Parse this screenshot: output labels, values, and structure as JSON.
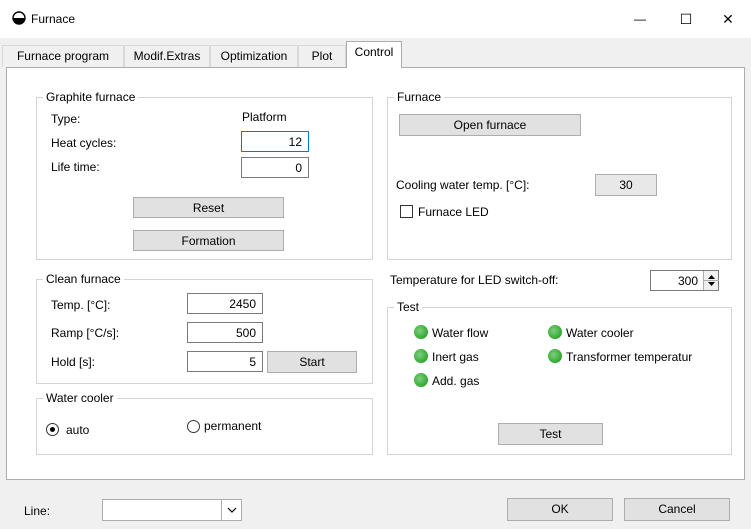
{
  "window": {
    "title": "Furnace",
    "minimize_glyph": "—",
    "maximize_glyph": "☐",
    "close_glyph": "✕"
  },
  "tabs": [
    {
      "label": "Furnace program"
    },
    {
      "label": "Modif.Extras"
    },
    {
      "label": "Optimization"
    },
    {
      "label": "Plot"
    },
    {
      "label": "Control"
    }
  ],
  "graphite_furnace": {
    "title": "Graphite furnace",
    "type_label": "Type:",
    "type_value": "Platform",
    "heat_cycles_label": "Heat cycles:",
    "heat_cycles_value": "12",
    "life_time_label": "Life time:",
    "life_time_value": "0",
    "reset_label": "Reset",
    "formation_label": "Formation"
  },
  "clean_furnace": {
    "title": "Clean furnace",
    "temp_label": "Temp. [°C]:",
    "temp_value": "2450",
    "ramp_label": "Ramp [°C/s]:",
    "ramp_value": "500",
    "hold_label": "Hold [s]:",
    "hold_value": "5",
    "start_label": "Start"
  },
  "water_cooler": {
    "title": "Water cooler",
    "auto_label": "auto",
    "permanent_label": "permanent"
  },
  "furnace": {
    "title": "Furnace",
    "open_label": "Open furnace",
    "cooling_label": "Cooling water temp. [°C]:",
    "cooling_value": "30",
    "led_label": "Furnace LED"
  },
  "led_switch_off": {
    "label": "Temperature for LED switch-off:",
    "value": "300"
  },
  "test": {
    "title": "Test",
    "indicators": [
      {
        "label": "Water flow"
      },
      {
        "label": "Water cooler"
      },
      {
        "label": "Inert gas"
      },
      {
        "label": "Transformer temperatur"
      },
      {
        "label": "Add. gas"
      }
    ],
    "test_label": "Test"
  },
  "footer": {
    "line_label": "Line:",
    "ok_label": "OK",
    "cancel_label": "Cancel"
  },
  "colors": {
    "led_green": "#2fa82f",
    "focus_blue": "#0078d7"
  }
}
